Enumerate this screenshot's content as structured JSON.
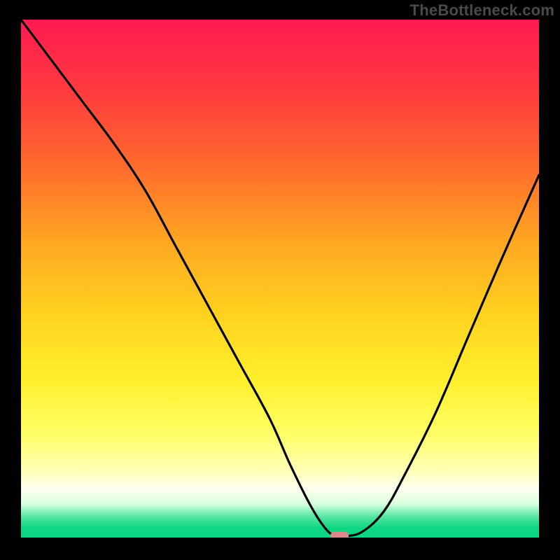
{
  "watermark": "TheBottleneck.com",
  "chart_data": {
    "type": "line",
    "title": "",
    "xlabel": "",
    "ylabel": "",
    "xlim": [
      0,
      100
    ],
    "ylim": [
      0,
      100
    ],
    "curve_x": [
      0,
      6,
      12,
      18,
      24,
      30,
      36,
      42,
      48,
      52,
      56,
      59,
      61,
      63,
      66,
      70,
      74,
      80,
      86,
      92,
      100
    ],
    "curve_y": [
      100,
      92,
      84,
      76,
      67,
      56,
      45,
      34,
      23,
      14,
      6,
      1.5,
      0.3,
      0.3,
      1.2,
      5,
      12,
      24,
      38,
      52,
      70
    ],
    "notch": {
      "x": 61.5,
      "y": 0.3,
      "color": "#d98a88"
    },
    "gradient_stops": [
      {
        "offset": 0.0,
        "color": "#ff1a52"
      },
      {
        "offset": 0.14,
        "color": "#ff3b3f"
      },
      {
        "offset": 0.28,
        "color": "#ff6a2d"
      },
      {
        "offset": 0.43,
        "color": "#ffa722"
      },
      {
        "offset": 0.57,
        "color": "#ffd21e"
      },
      {
        "offset": 0.7,
        "color": "#fff02e"
      },
      {
        "offset": 0.8,
        "color": "#ffff66"
      },
      {
        "offset": 0.87,
        "color": "#ffffb5"
      },
      {
        "offset": 0.905,
        "color": "#fffff0"
      },
      {
        "offset": 0.935,
        "color": "#d8ffde"
      },
      {
        "offset": 0.96,
        "color": "#54e6a0"
      },
      {
        "offset": 0.982,
        "color": "#0cd681"
      },
      {
        "offset": 1.0,
        "color": "#0cd681"
      }
    ]
  }
}
